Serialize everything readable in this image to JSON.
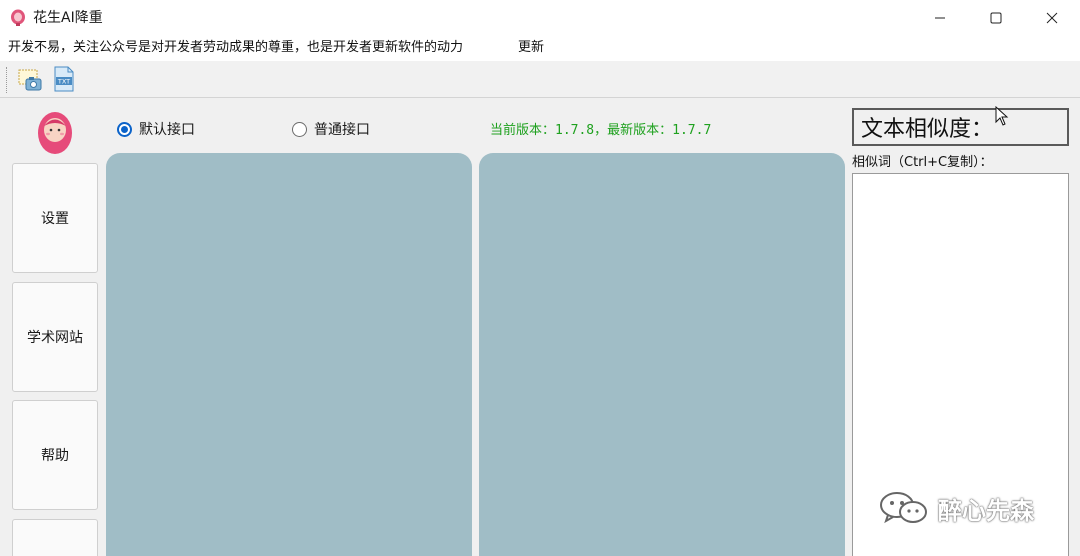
{
  "window": {
    "title": "花生AI降重",
    "minimize_icon": "minimize-icon",
    "maximize_icon": "maximize-icon",
    "close_icon": "close-icon"
  },
  "notice": {
    "text": "开发不易，关注公众号是对开发者劳动成果的尊重，也是开发者更新软件的动力",
    "update_link": "更新"
  },
  "toolbar": {
    "items": [
      {
        "icon": "screenshot-icon"
      },
      {
        "icon": "txt-file-icon",
        "badge": "TXT"
      }
    ]
  },
  "sidebar": {
    "items": [
      {
        "label": "设置"
      },
      {
        "label": "学术网站"
      },
      {
        "label": "帮助"
      },
      {
        "label": ""
      }
    ]
  },
  "interface": {
    "options": [
      {
        "label": "默认接口",
        "selected": true
      },
      {
        "label": "普通接口",
        "selected": false
      }
    ]
  },
  "version_text": "当前版本：1.7.8，最新版本：1.7.7",
  "similarity": {
    "title": "文本相似度：",
    "words_label": "相似词（Ctrl+C复制）：",
    "words_value": ""
  },
  "watermark": {
    "text": "醉心先森"
  },
  "colors": {
    "panel": "#a0bdc6",
    "version_green": "#1fa11f",
    "radio_blue": "#0b63c9"
  }
}
